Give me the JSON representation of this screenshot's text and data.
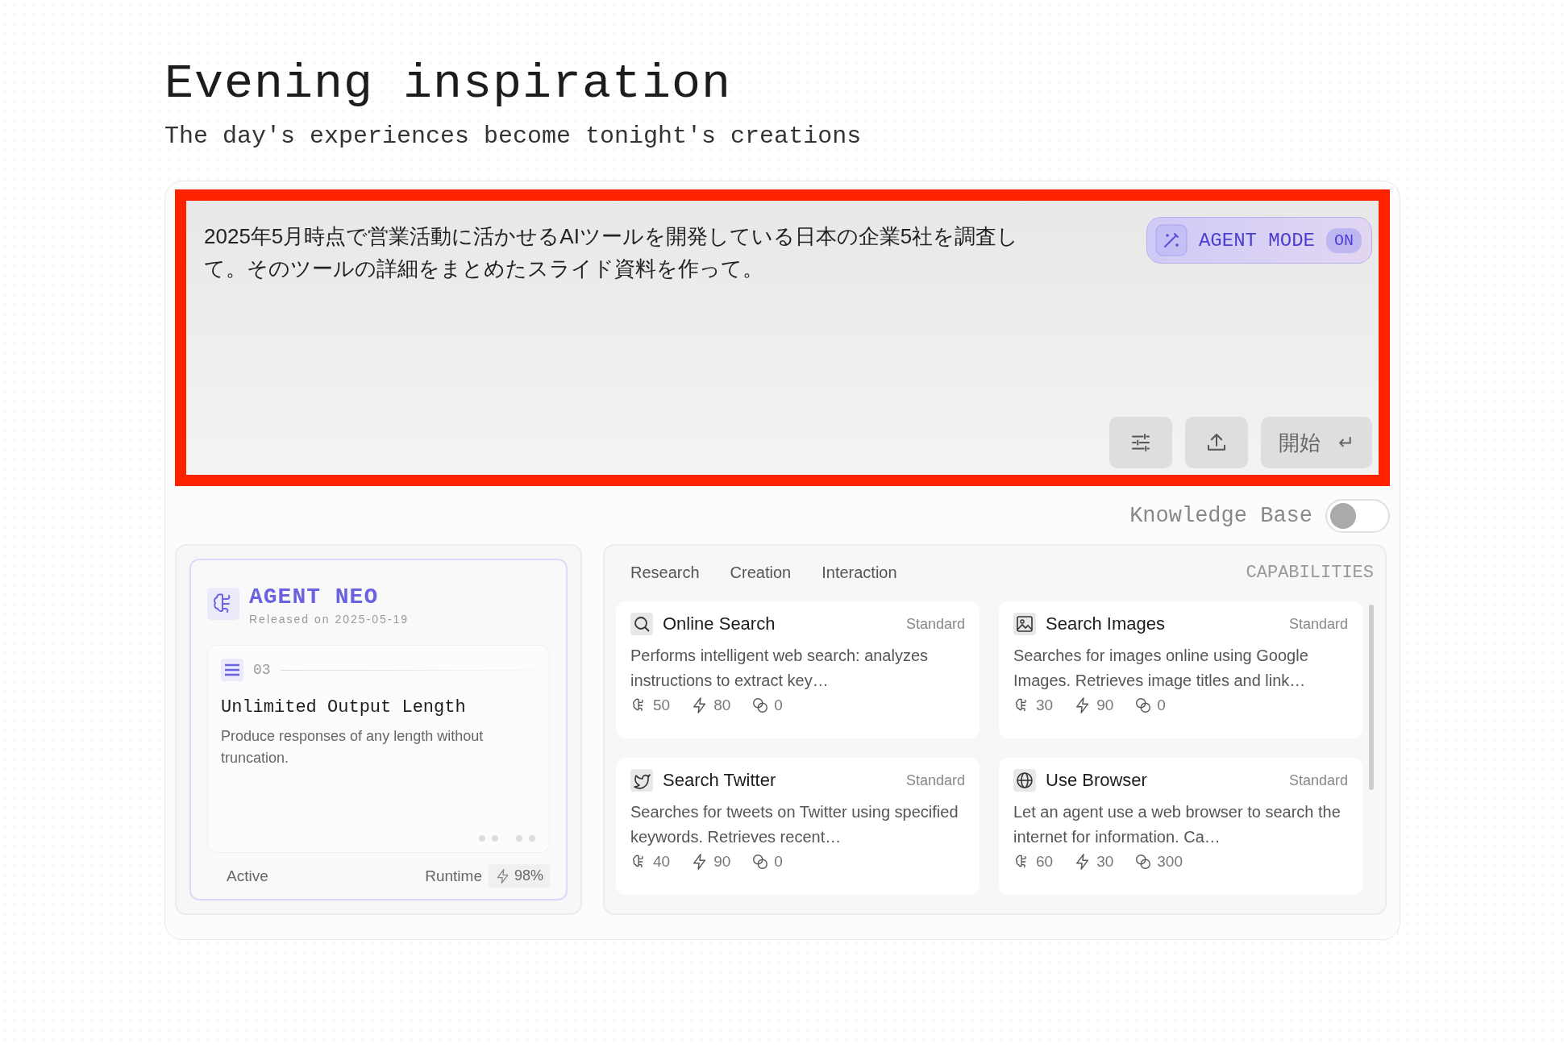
{
  "heading": {
    "title": "Evening inspiration",
    "subtitle": "The day's experiences become tonight's creations"
  },
  "prompt": {
    "value": "2025年5月時点で営業活動に活かせるAIツールを開発している日本の企業5社を調査して。そのツールの詳細をまとめたスライド資料を作って。",
    "agent_mode": {
      "label": "AGENT MODE",
      "state": "ON",
      "on": true
    },
    "start_button": {
      "label": "開始",
      "key": "↵"
    }
  },
  "knowledge_base": {
    "label": "Knowledge Base",
    "on": false
  },
  "agent": {
    "name": "AGENT NEO",
    "released": "Released on 2025-05-19",
    "feature": {
      "number": "03",
      "title": "Unlimited Output Length",
      "description": "Produce responses of any length without truncation."
    },
    "status": "Active",
    "runtime_label": "Runtime",
    "runtime": "98%"
  },
  "capabilities": {
    "title": "CAPABILITIES",
    "tabs": [
      {
        "label": "Research",
        "selected": false
      },
      {
        "label": "Creation",
        "selected": false
      },
      {
        "label": "Interaction",
        "selected": false
      }
    ],
    "items": [
      {
        "kind": "search",
        "name": "Online Search",
        "tier": "Standard",
        "description": "Performs intelligent web search: analyzes instructions to extract key…",
        "stats": [
          "50",
          "80",
          "0"
        ]
      },
      {
        "kind": "image",
        "name": "Search Images",
        "tier": "Standard",
        "description": "Searches for images online using Google Images. Retrieves image titles and link…",
        "stats": [
          "30",
          "90",
          "0"
        ]
      },
      {
        "kind": "bird",
        "name": "Search Twitter",
        "tier": "Standard",
        "description": "Searches for tweets on Twitter using specified keywords. Retrieves recent…",
        "stats": [
          "40",
          "90",
          "0"
        ]
      },
      {
        "kind": "globe",
        "name": "Use Browser",
        "tier": "Standard",
        "description": "Let an agent use a web browser to search the internet for information. Ca…",
        "stats": [
          "60",
          "30",
          "300"
        ]
      }
    ]
  }
}
